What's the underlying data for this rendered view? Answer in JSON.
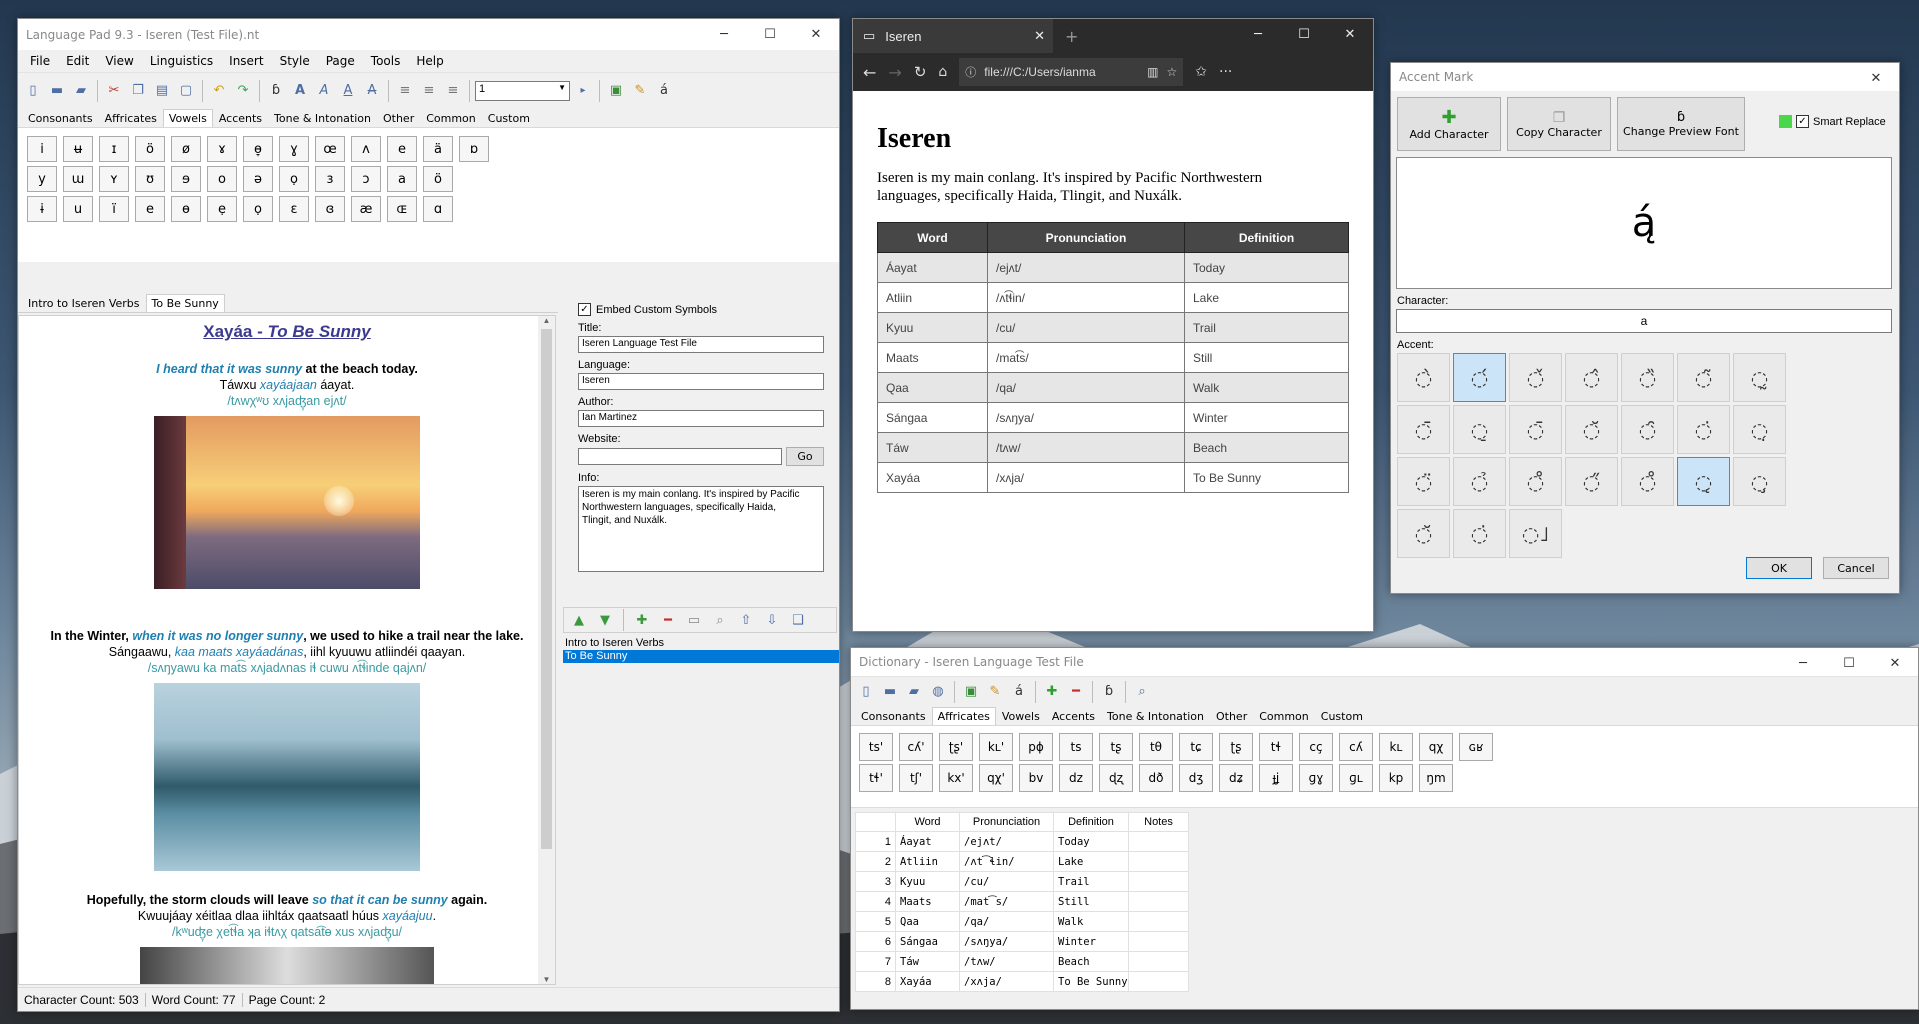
{
  "lp": {
    "title": "Language Pad 9.3 - Iseren (Test File).nt",
    "menus": [
      "File",
      "Edit",
      "View",
      "Linguistics",
      "Insert",
      "Style",
      "Page",
      "Tools",
      "Help"
    ],
    "font_size": "1",
    "char_tabs": [
      "Consonants",
      "Affricates",
      "Vowels",
      "Accents",
      "Tone & Intonation",
      "Other",
      "Common",
      "Custom"
    ],
    "vowels": [
      [
        "i",
        "ʉ",
        "ɪ",
        "ö",
        "ø",
        "ɤ",
        "ɵ̞",
        "ɣ",
        "œ",
        "ʌ",
        "e",
        "ä",
        "ɒ"
      ],
      [
        "y",
        "ɯ",
        "ʏ",
        "ʊ",
        "ɘ",
        "o",
        "ə",
        "ọ",
        "ɜ",
        "ɔ",
        "a",
        "ö"
      ],
      [
        "ɨ",
        "u",
        "ï",
        "e",
        "ɵ",
        "ẹ",
        "ọ",
        "ɛ",
        "ɞ",
        "æ",
        "ɶ",
        "ɑ"
      ]
    ],
    "doc_tabs": [
      "Intro to Iseren Verbs",
      "To Be Sunny"
    ],
    "doc": {
      "heading": "Xayáa - To Be Sunny",
      "heading_a": "Xayáa - ",
      "heading_b": "To Be Sunny",
      "p1_a": "I heard that it was sunny",
      "p1_b": " at the beach today.",
      "p1_line2_a": "Táwxu ",
      "p1_line2_b": "xayáajaan",
      "p1_line2_c": " áayat.",
      "p1_ipa": "/tʌwχʷʊ xʌjaʤ̞an ejʌt/",
      "p2_a": "In the Winter, ",
      "p2_b": "when it was no longer sunny",
      "p2_c": ", we used to hike a trail near the lake.",
      "p2_line2_a": "Sángaawu, ",
      "p2_line2_b": "kaa maats xayáadánas",
      "p2_line2_c": ", iihl kyuuwu atliindéi qaayan.",
      "p2_ipa": "/sʌŋyawu ka mat͡s xʌjadʌnas iɬ cuwu ʌt͡ɬinde qajʌn/",
      "p3_a": "Hopefully, the storm clouds will leave ",
      "p3_b": "so that it can be sunny",
      "p3_c": " again.",
      "p3_line2_a": "Kwuujáay xéitlaa dlaa iihltáx qaatsaatl húus ",
      "p3_line2_b": "xayáajuu",
      "p3_line2_c": ".",
      "p3_ipa": "/kʷuʤ̞e χet͡ɬa ʞa iɬtʌχ qatsa͡tɵ xus xʌjaʤ̞u/"
    },
    "props": {
      "embed_label": "Embed Custom Symbols",
      "title_label": "Title:",
      "title_value": "Iseren Language Test File",
      "language_label": "Language:",
      "language_value": "Iseren",
      "author_label": "Author:",
      "author_value": "Ian Martinez",
      "website_label": "Website:",
      "website_value": "",
      "go_label": "Go",
      "info_label": "Info:",
      "info_value": "Iseren is my main conlang. It's inspired by Pacific Northwestern languages, specifically Haida, Tlingit, and Nuxálk."
    },
    "pages": [
      "Intro to Iseren Verbs",
      "To Be Sunny"
    ],
    "status": [
      "Character Count: 503",
      "Word Count: 77",
      "Page Count: 2"
    ]
  },
  "browser": {
    "tab_title": "Iseren",
    "url": "file:///C:/Users/ianma",
    "heading": "Iseren",
    "intro": "Iseren is my main conlang. It's inspired by Pacific Northwestern languages, specifically Haida, Tlingit, and Nuxálk.",
    "columns": [
      "Word",
      "Pronunciation",
      "Definition"
    ],
    "rows": [
      [
        "Áayat",
        "/ejʌt/",
        "Today"
      ],
      [
        "Atliin",
        "/ʌt͡ɬin/",
        "Lake"
      ],
      [
        "Kyuu",
        "/cu/",
        "Trail"
      ],
      [
        "Maats",
        "/mat͡s/",
        "Still"
      ],
      [
        "Qaa",
        "/qa/",
        "Walk"
      ],
      [
        "Sángaa",
        "/sʌŋya/",
        "Winter"
      ],
      [
        "Táw",
        "/tʌw/",
        "Beach"
      ],
      [
        "Xayáa",
        "/xʌja/",
        "To Be Sunny"
      ]
    ]
  },
  "accent": {
    "title": "Accent Mark",
    "add_label": "Add Character",
    "copy_label": "Copy Character",
    "font_label": "Change Preview Font",
    "smart_label": "Smart Replace",
    "preview": "ą́",
    "character_label": "Character:",
    "character_value": "a",
    "accent_label": "Accent:",
    "accents": [
      "◌̀",
      "◌́",
      "◌̌",
      "◌̂",
      "◌̏",
      "◌̃",
      "◌̰",
      "◌̄",
      "◌̠",
      "◌̄",
      "◌̆",
      "◌̑",
      "◌̇",
      "◌̣",
      "◌̈",
      "◌̉",
      "◌̊",
      "◌̋",
      "◌̊",
      "◌̨",
      "◌̧",
      "◌̆",
      "◌̇",
      "◌˩"
    ],
    "ok_label": "OK",
    "cancel_label": "Cancel",
    "accent_color": "#4bd64b"
  },
  "dict": {
    "title": "Dictionary - Iseren Language Test File",
    "tabs": [
      "Consonants",
      "Affricates",
      "Vowels",
      "Accents",
      "Tone & Intonation",
      "Other",
      "Common",
      "Custom"
    ],
    "affricates": [
      [
        "ts'",
        "cʎ'",
        "ʈʂ'",
        "kʟ'",
        "pɸ",
        "ts",
        "tʂ",
        "tθ",
        "tɕ",
        "ʈʂ",
        "tɬ",
        "cç",
        "cʎ",
        "kʟ",
        "qχ",
        "ɢʁ"
      ],
      [
        "tɬ'",
        "tʃ'",
        "kx'",
        "qχ'",
        "bv",
        "dz",
        "ɖʐ",
        "dð",
        "dʒ",
        "dʑ",
        "ɟʝ",
        "ɡɣ",
        "ɡʟ",
        "kp",
        "ŋm"
      ]
    ],
    "columns": [
      "Word",
      "Pronunciation",
      "Definition",
      "Notes"
    ],
    "rows": [
      [
        "1",
        "Áayat",
        "/ejʌt/",
        "Today",
        ""
      ],
      [
        "2",
        "Atliin",
        "/ʌt͡ɬin/",
        "Lake",
        ""
      ],
      [
        "3",
        "Kyuu",
        "/cu/",
        "Trail",
        ""
      ],
      [
        "4",
        "Maats",
        "/mat͡s/",
        "Still",
        ""
      ],
      [
        "5",
        "Qaa",
        "/qa/",
        "Walk",
        ""
      ],
      [
        "6",
        "Sángaa",
        "/sʌŋya/",
        "Winter",
        ""
      ],
      [
        "7",
        "Táw",
        "/tʌw/",
        "Beach",
        ""
      ],
      [
        "8",
        "Xayáa",
        "/xʌja/",
        "To Be Sunny",
        ""
      ]
    ]
  }
}
